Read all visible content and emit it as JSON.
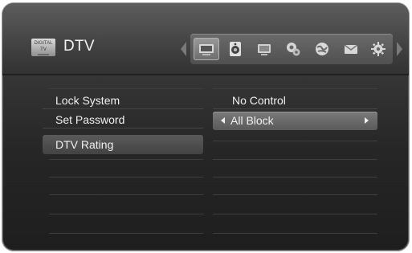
{
  "header": {
    "title": "DTV",
    "app_icon": "tv-icon",
    "app_icon_text": "DIGITAL TV"
  },
  "icon_bar": {
    "icons": [
      "tv-setup-icon",
      "speaker-icon",
      "monitor-icon",
      "settings-gears-icon",
      "network-globe-icon",
      "envelope-icon",
      "gear-icon"
    ],
    "selected_index": 0
  },
  "menu": {
    "items": [
      {
        "label": "Lock System"
      },
      {
        "label": "Set Password"
      },
      {
        "label": "DTV Rating"
      }
    ],
    "selected_index": 2
  },
  "options": {
    "items": [
      {
        "label": "No Control"
      },
      {
        "label": "All Block"
      }
    ],
    "active_index": 1
  },
  "colors": {
    "text": "#f0f0f0",
    "panel": "#262626",
    "highlight": "#6a6a6a"
  }
}
